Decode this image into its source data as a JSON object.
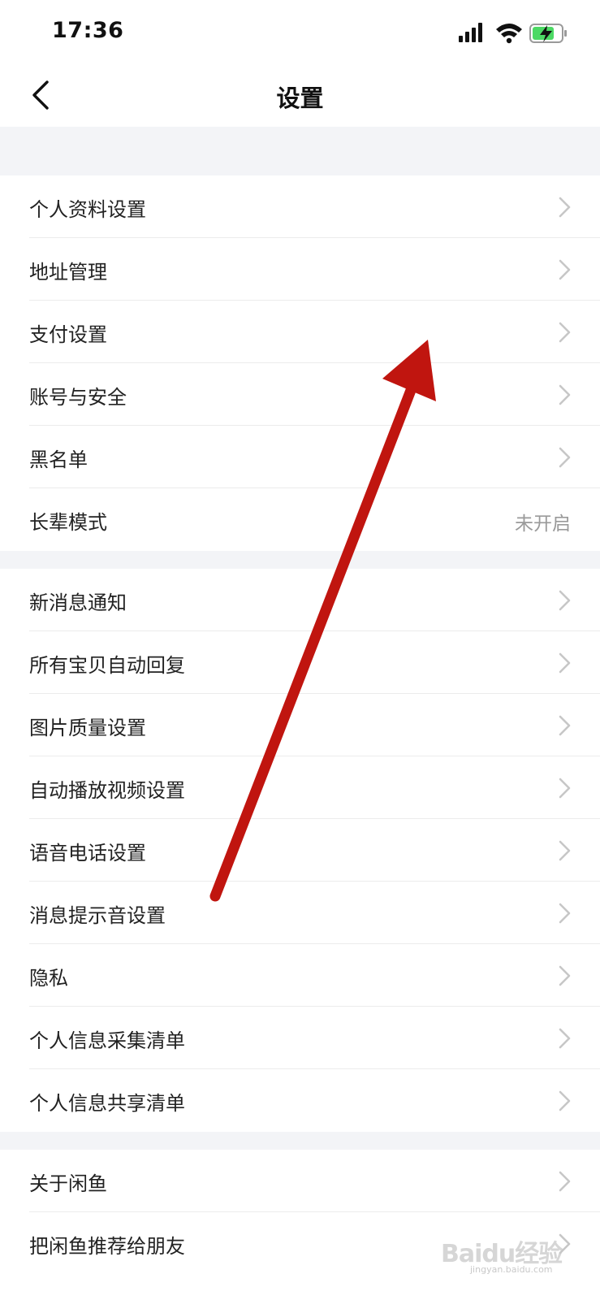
{
  "status_bar": {
    "time": "17:36",
    "icons": [
      "signal-icon",
      "wifi-icon",
      "battery-charging-icon"
    ],
    "battery_color": "#4cd964"
  },
  "nav": {
    "back_icon": "chevron-left-icon",
    "title": "设置"
  },
  "groups": [
    {
      "items": [
        {
          "label": "个人资料设置",
          "chevron": true
        },
        {
          "label": "地址管理",
          "chevron": true
        },
        {
          "label": "支付设置",
          "chevron": true
        },
        {
          "label": "账号与安全",
          "chevron": true
        },
        {
          "label": "黑名单",
          "chevron": true
        },
        {
          "label": "长辈模式",
          "value": "未开启",
          "chevron": false
        }
      ]
    },
    {
      "items": [
        {
          "label": "新消息通知",
          "chevron": true
        },
        {
          "label": "所有宝贝自动回复",
          "chevron": true
        },
        {
          "label": "图片质量设置",
          "chevron": true
        },
        {
          "label": "自动播放视频设置",
          "chevron": true
        },
        {
          "label": "语音电话设置",
          "chevron": true
        },
        {
          "label": "消息提示音设置",
          "chevron": true
        },
        {
          "label": "隐私",
          "chevron": true
        },
        {
          "label": "个人信息采集清单",
          "chevron": true
        },
        {
          "label": "个人信息共享清单",
          "chevron": true
        }
      ]
    },
    {
      "items": [
        {
          "label": "关于闲鱼",
          "chevron": true
        },
        {
          "label": "把闲鱼推荐给朋友",
          "chevron": true
        }
      ]
    }
  ],
  "annotation": {
    "icon": "red-arrow-annotation",
    "color": "#c0150f"
  },
  "watermark": {
    "brand": "Baidu经验",
    "url": "jingyan.baidu.com"
  }
}
